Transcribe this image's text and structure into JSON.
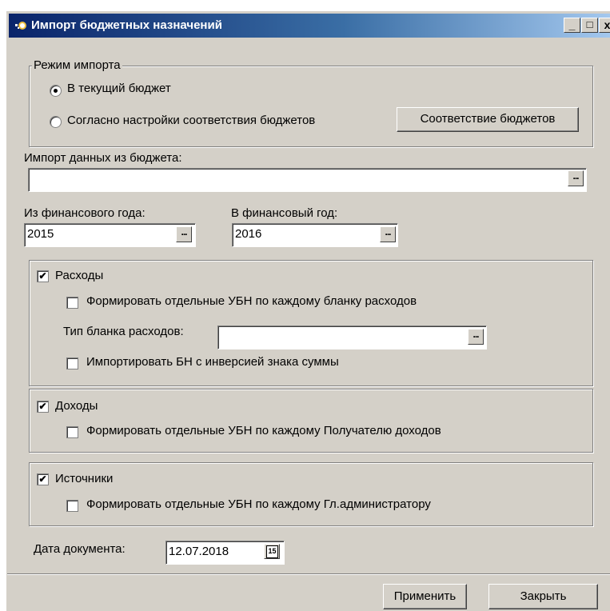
{
  "window": {
    "title": "Импорт бюджетных назначений",
    "minimize": "_",
    "maximize": "□",
    "close": "x"
  },
  "import_mode": {
    "legend": "Режим импорта",
    "option_current": "В текущий бюджет",
    "option_mapping": "Согласно настройки соответствия бюджетов",
    "mapping_button": "Соответствие бюджетов",
    "selected": "option_current"
  },
  "source_budget": {
    "label": "Импорт данных из бюджета:",
    "value": ""
  },
  "from_year": {
    "label": "Из финансового года:",
    "value": "2015"
  },
  "to_year": {
    "label": "В финансовый год:",
    "value": "2016"
  },
  "expenses": {
    "label": "Расходы",
    "checked": true,
    "separate_label": "Формировать отдельные УБН  по каждому бланку расходов",
    "separate_checked": false,
    "blank_type_label": "Тип бланка расходов:",
    "blank_type_value": "",
    "inversion_label": "Импортировать БН с инверсией знака суммы",
    "inversion_checked": false
  },
  "income": {
    "label": "Доходы",
    "checked": true,
    "separate_label": "Формировать отдельные УБН по каждому Получателю доходов",
    "separate_checked": false
  },
  "sources": {
    "label": "Источники",
    "checked": true,
    "separate_label": "Формировать отдельные УБН по каждому Гл.администратору",
    "separate_checked": false
  },
  "doc_date": {
    "label": "Дата документа:",
    "value": "12.07.2018",
    "calendar_icon_text": "15"
  },
  "footer": {
    "apply": "Применить",
    "close": "Закрыть"
  },
  "ellipsis": "...",
  "checkmark": "✔"
}
